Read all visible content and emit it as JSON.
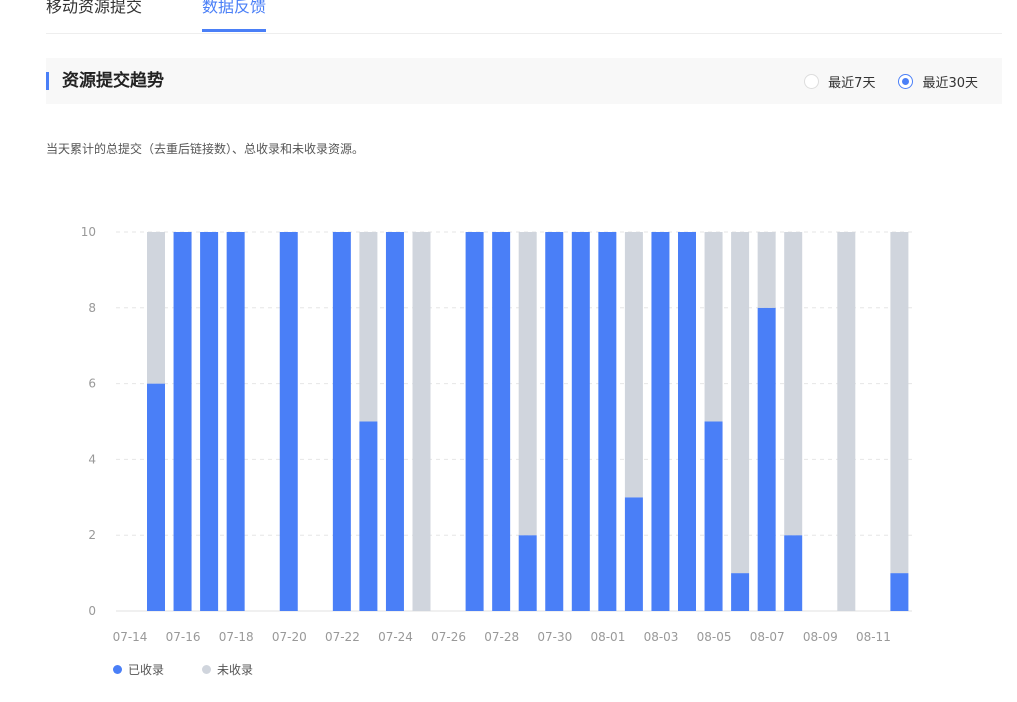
{
  "tabs": [
    {
      "label": "移动资源提交",
      "active": false
    },
    {
      "label": "数据反馈",
      "active": true
    }
  ],
  "section": {
    "title": "资源提交趋势",
    "range_options": [
      {
        "label": "最近7天",
        "checked": false
      },
      {
        "label": "最近30天",
        "checked": true
      }
    ]
  },
  "description": "当天累计的总提交（去重后链接数）、总收录和未收录资源。",
  "colors": {
    "accent": "#4a7ff7",
    "indexed": "#4a7ff7",
    "not_indexed": "#d0d5dd"
  },
  "chart_data": {
    "type": "bar",
    "stacked": true,
    "categories": [
      "07-14",
      "07-15",
      "07-16",
      "07-17",
      "07-18",
      "07-19",
      "07-20",
      "07-21",
      "07-22",
      "07-23",
      "07-24",
      "07-25",
      "07-26",
      "07-27",
      "07-28",
      "07-29",
      "07-30",
      "07-31",
      "08-01",
      "08-02",
      "08-03",
      "08-04",
      "08-05",
      "08-06",
      "08-07",
      "08-08",
      "08-09",
      "08-10",
      "08-11"
    ],
    "tick_labels": [
      "07-14",
      "07-16",
      "07-18",
      "07-20",
      "07-22",
      "07-24",
      "07-26",
      "07-28",
      "07-30",
      "08-01",
      "08-03",
      "08-05",
      "08-07",
      "08-09",
      "08-11"
    ],
    "series": [
      {
        "name": "已收录",
        "color": "#4a7ff7",
        "values": [
          6,
          10,
          10,
          10,
          0,
          10,
          0,
          10,
          5,
          10,
          0,
          0,
          10,
          10,
          2,
          10,
          10,
          10,
          3,
          10,
          10,
          5,
          1,
          8,
          2,
          0,
          0,
          0,
          1
        ]
      },
      {
        "name": "未收录",
        "color": "#d0d5dd",
        "values": [
          4,
          0,
          0,
          0,
          0,
          0,
          0,
          0,
          5,
          0,
          10,
          0,
          0,
          0,
          8,
          0,
          0,
          0,
          7,
          0,
          0,
          5,
          9,
          2,
          8,
          0,
          10,
          0,
          9
        ]
      }
    ],
    "ylim": [
      0,
      10
    ],
    "yticks": [
      0,
      2,
      4,
      6,
      8,
      10
    ],
    "grid": true,
    "legend": "bottom-left"
  }
}
